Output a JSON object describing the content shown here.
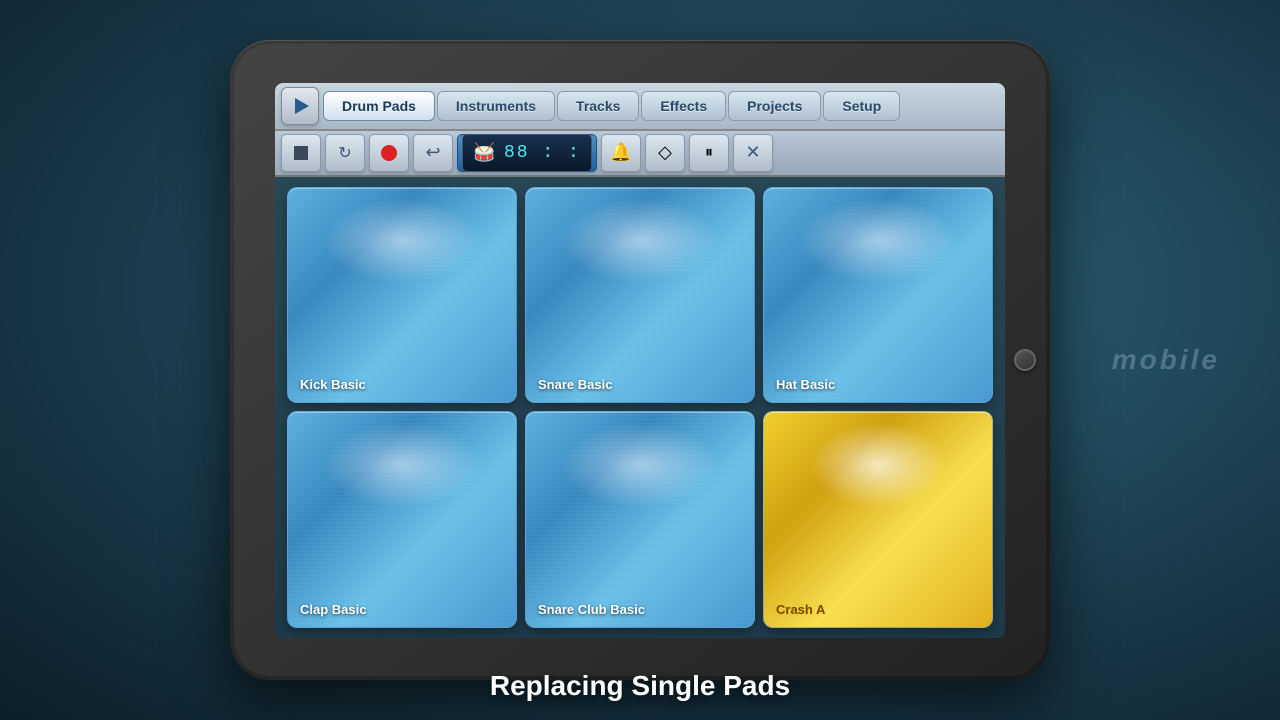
{
  "app": {
    "title": "Drum Pads",
    "subtitle": "Replacing Single Pads"
  },
  "nav": {
    "tabs": [
      {
        "id": "drum-pads",
        "label": "Drum Pads",
        "active": true
      },
      {
        "id": "instruments",
        "label": "Instruments",
        "active": false
      },
      {
        "id": "tracks",
        "label": "Tracks",
        "active": false
      },
      {
        "id": "effects",
        "label": "Effects",
        "active": false
      },
      {
        "id": "projects",
        "label": "Projects",
        "active": false
      },
      {
        "id": "setup",
        "label": "Setup",
        "active": false
      }
    ]
  },
  "toolbar": {
    "bpm": "88",
    "time_sig": ": :"
  },
  "pads": [
    {
      "id": "kick",
      "label": "Kick Basic",
      "color": "blue",
      "row": 0,
      "col": 0
    },
    {
      "id": "snare",
      "label": "Snare Basic",
      "color": "blue",
      "row": 0,
      "col": 1
    },
    {
      "id": "hat",
      "label": "Hat Basic",
      "color": "blue",
      "row": 0,
      "col": 2
    },
    {
      "id": "clap",
      "label": "Clap Basic",
      "color": "blue",
      "row": 1,
      "col": 0
    },
    {
      "id": "snare-club",
      "label": "Snare Club Basic",
      "color": "blue",
      "row": 1,
      "col": 1
    },
    {
      "id": "crash",
      "label": "Crash A",
      "color": "yellow",
      "row": 1,
      "col": 2
    }
  ],
  "mobile_watermark": "mobile"
}
